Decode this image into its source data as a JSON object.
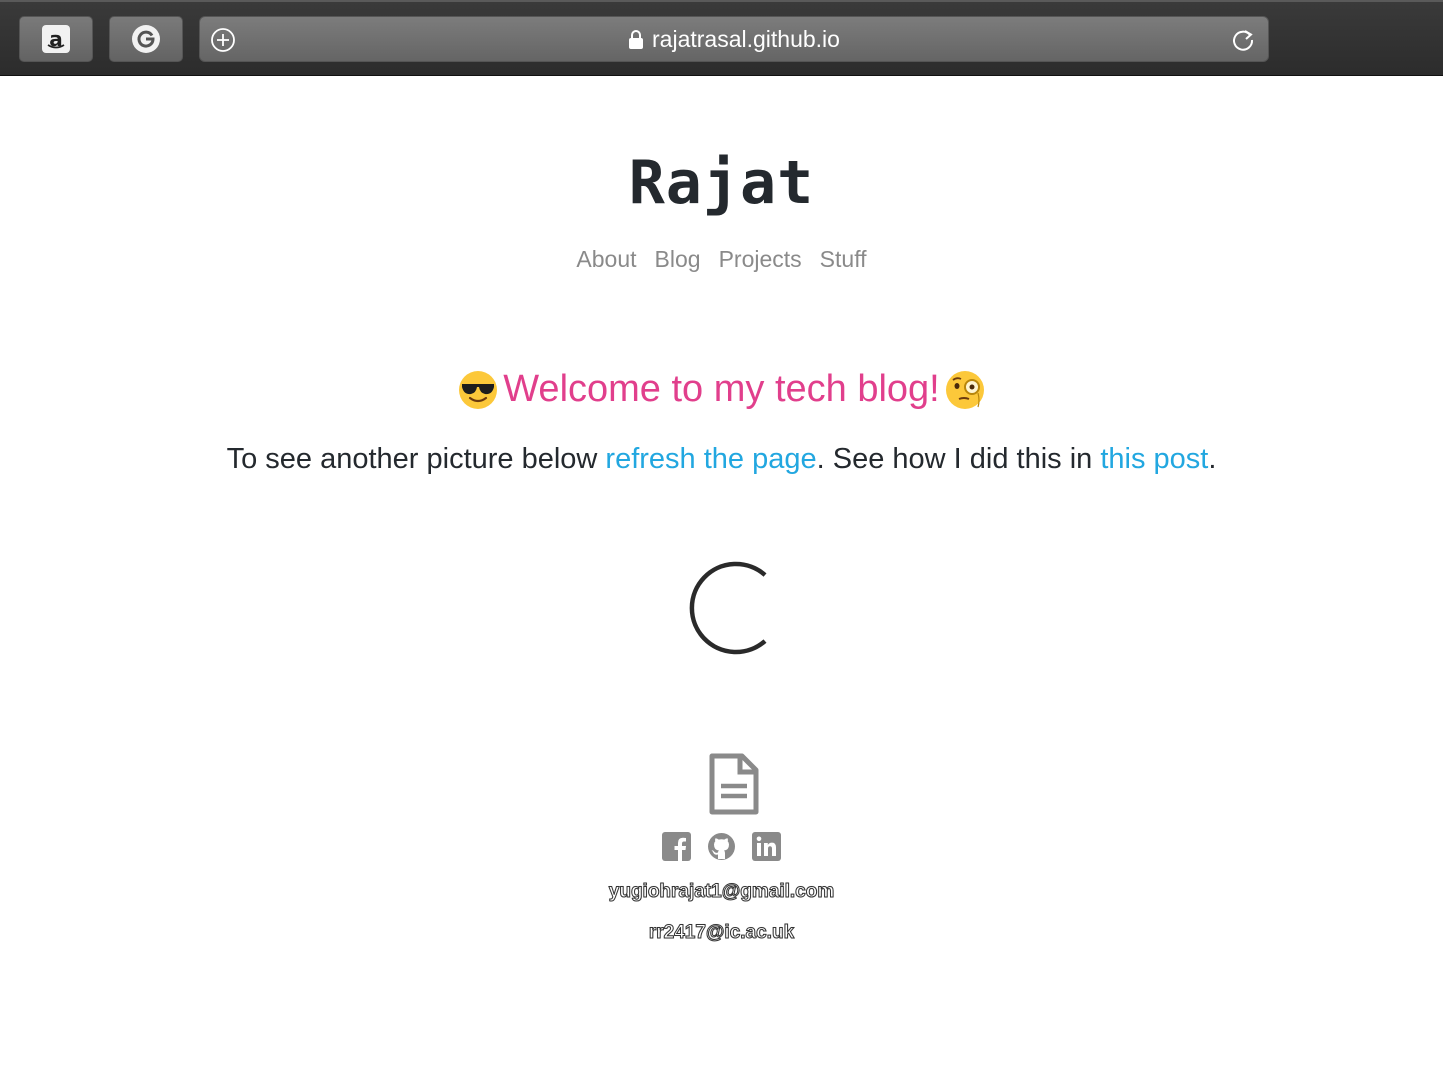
{
  "browser": {
    "url": "rajatrasal.github.io",
    "favorites": [
      "amazon-icon",
      "google-icon"
    ],
    "amazon_glyph": "a",
    "icons": {
      "new_tab": "plus-circle-icon",
      "lock": "lock-icon",
      "reload": "reload-icon"
    }
  },
  "site": {
    "title": "Rajat",
    "nav": {
      "about": "About",
      "blog": "Blog",
      "projects": "Projects",
      "stuff": "Stuff"
    }
  },
  "main": {
    "welcome": "Welcome to my tech blog!",
    "intro_part1": "To see another picture below ",
    "intro_link1": "refresh the page",
    "intro_part2": ". See how I did this in ",
    "intro_link2": "this post",
    "intro_part3": "."
  },
  "footer": {
    "icons": [
      "document-icon",
      "facebook-icon",
      "github-icon",
      "linkedin-icon"
    ],
    "email_1": "yugiohrajat1@gmail.com",
    "email_2": "rr2417@ic.ac.uk"
  },
  "colors": {
    "accent_pink": "#e13f8c",
    "link_blue": "#22a7e0",
    "text_dark": "#24292e",
    "nav_gray": "#8a8a8a"
  }
}
